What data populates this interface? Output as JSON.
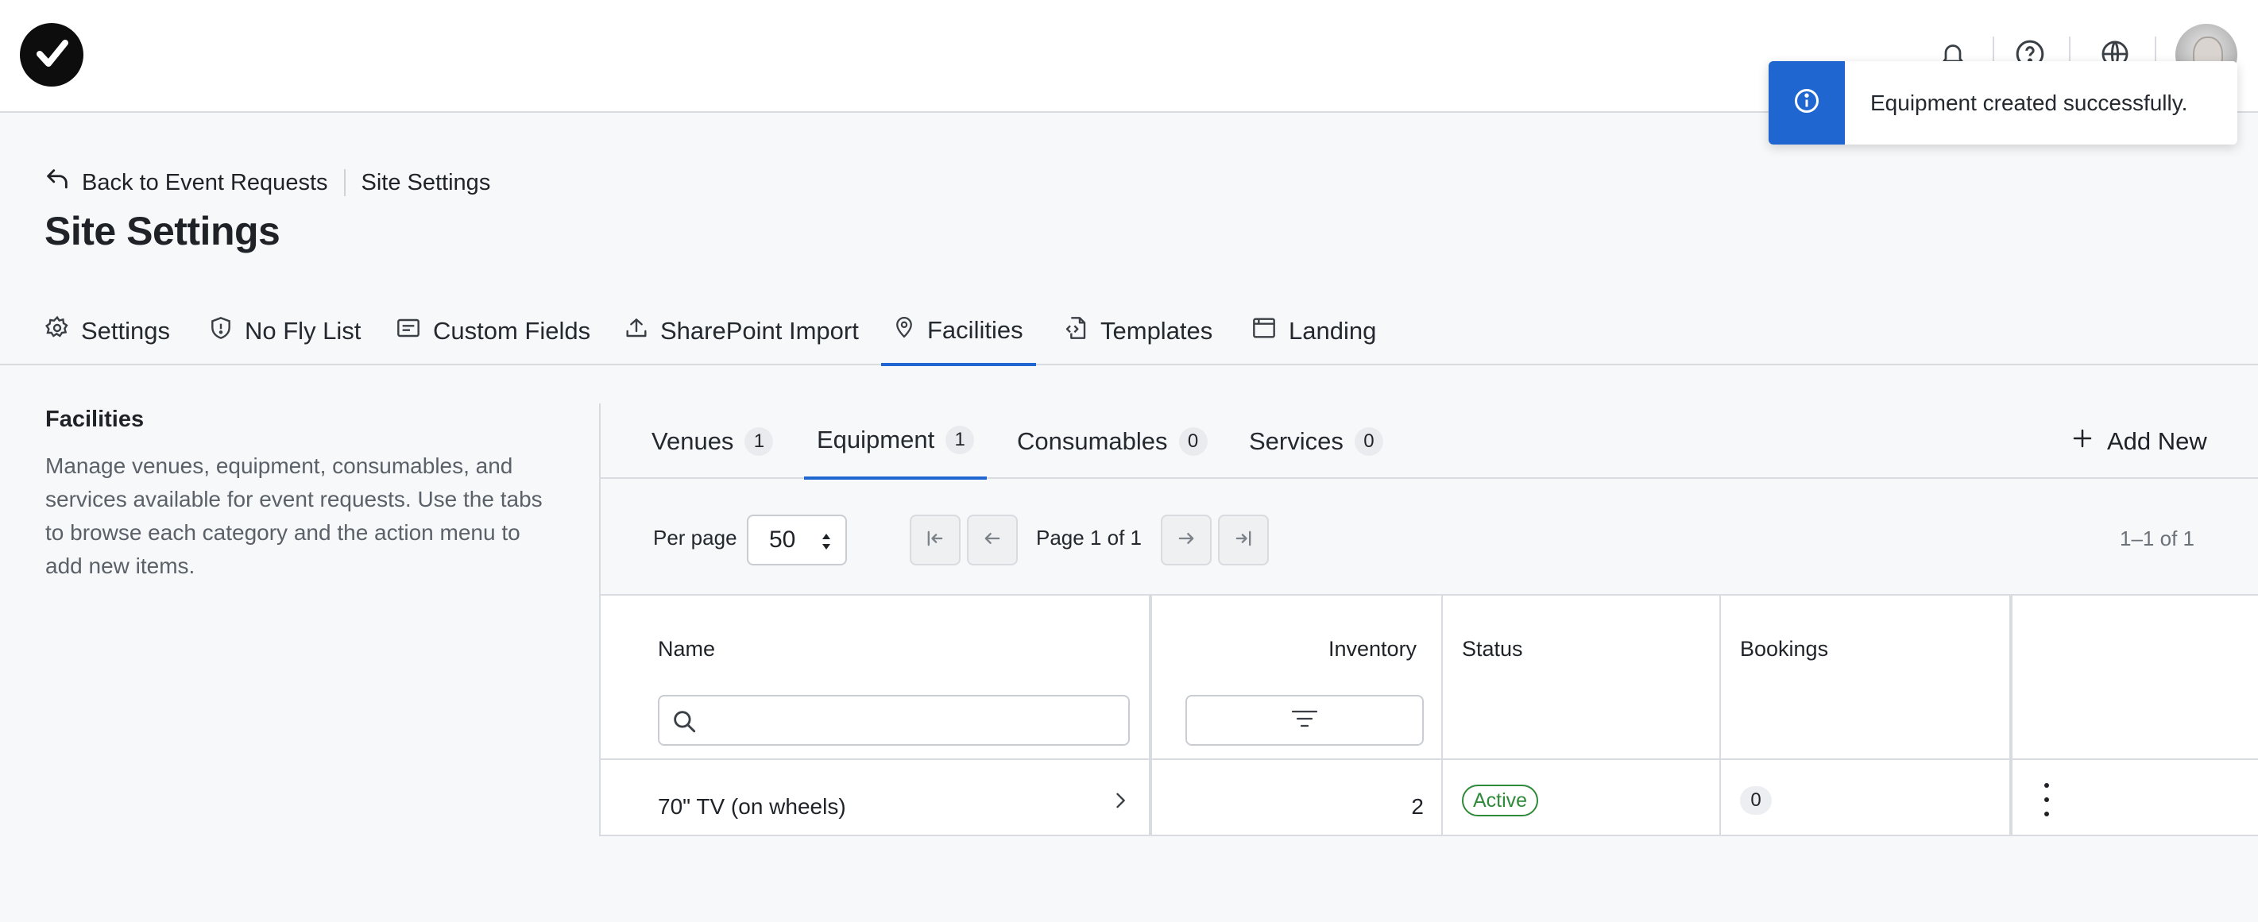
{
  "header": {
    "logo_icon": "check-circle-logo",
    "icons": [
      "bell-icon",
      "help-icon",
      "globe-icon"
    ],
    "avatar": "user-avatar"
  },
  "toast": {
    "icon": "info-icon",
    "message": "Equipment created successfully.",
    "accent": "#1f66d1"
  },
  "breadcrumb": {
    "back_label": "Back to Event Requests",
    "current": "Site Settings"
  },
  "page_title": "Site Settings",
  "main_tabs": [
    {
      "label": "Settings",
      "icon": "gear-icon"
    },
    {
      "label": "No Fly List",
      "icon": "shield-icon"
    },
    {
      "label": "Custom Fields",
      "icon": "form-icon"
    },
    {
      "label": "SharePoint Import",
      "icon": "upload-icon"
    },
    {
      "label": "Facilities",
      "icon": "map-pin-icon",
      "active": true
    },
    {
      "label": "Templates",
      "icon": "template-icon"
    },
    {
      "label": "Landing",
      "icon": "browser-icon"
    }
  ],
  "section": {
    "title": "Facilities",
    "description": "Manage venues, equipment, consumables, and services available for event requests. Use the tabs to browse each category and the action menu to add new items."
  },
  "sub_tabs": [
    {
      "label": "Venues",
      "count": "1"
    },
    {
      "label": "Equipment",
      "count": "1",
      "active": true
    },
    {
      "label": "Consumables",
      "count": "0"
    },
    {
      "label": "Services",
      "count": "0"
    }
  ],
  "add_new_label": "Add New",
  "pagination": {
    "per_page_label": "Per page",
    "per_page_value": "50",
    "page_info": "Page 1 of 1",
    "range": "1–1 of 1"
  },
  "table": {
    "columns": [
      "Name",
      "Inventory",
      "Status",
      "Bookings"
    ],
    "rows": [
      {
        "name": "70\" TV (on wheels)",
        "inventory": "2",
        "status": "Active",
        "bookings": "0"
      }
    ]
  },
  "colors": {
    "accent": "#1f66d1",
    "status_active": "#2f8a3a"
  }
}
